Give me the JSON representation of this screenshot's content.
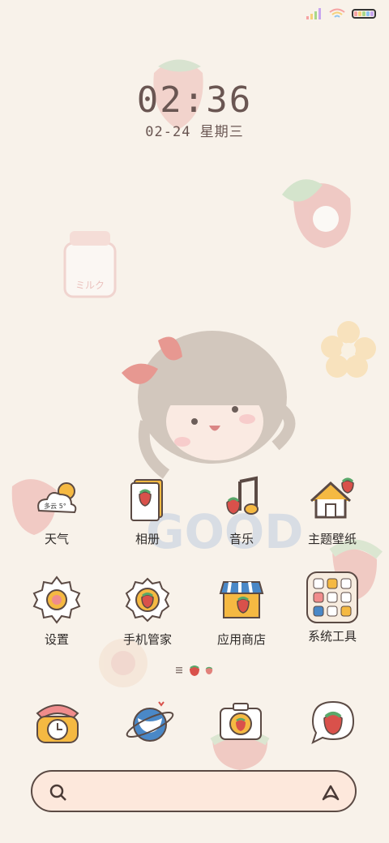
{
  "status_bar": {
    "signal_icon": "signal-icon",
    "wifi_icon": "wifi-icon",
    "battery_icon": "battery-icon",
    "battery_colors": [
      "#f6a3a3",
      "#f6d17a",
      "#a9d88a",
      "#8ec5f0",
      "#c7a6ef"
    ]
  },
  "lock": {
    "time": "02:36",
    "date": "02-24  星期三"
  },
  "wallpaper": {
    "good_text": "GOOD",
    "milk_text": "ミルク"
  },
  "apps": [
    {
      "label": "天气",
      "icon": "weather-icon",
      "weather_text": "多云 5°"
    },
    {
      "label": "相册",
      "icon": "photo-album-icon"
    },
    {
      "label": "音乐",
      "icon": "music-note-icon"
    },
    {
      "label": "主题壁纸",
      "icon": "theme-house-icon"
    },
    {
      "label": "设置",
      "icon": "settings-gear-icon"
    },
    {
      "label": "手机管家",
      "icon": "phone-manager-icon"
    },
    {
      "label": "应用商店",
      "icon": "app-store-icon"
    },
    {
      "label": "系统工具",
      "icon": "system-tools-folder-icon"
    }
  ],
  "dock": [
    {
      "icon": "phone-icon"
    },
    {
      "icon": "browser-planet-icon"
    },
    {
      "icon": "camera-icon"
    },
    {
      "icon": "messages-icon"
    }
  ],
  "page_indicator": {
    "menu_icon": "menu-lines-icon",
    "page_icons": [
      "strawberry-page-icon",
      "strawberry-small-page-icon"
    ]
  },
  "search_bar": {
    "search_icon": "search-icon",
    "assistant_icon": "assistant-icon"
  },
  "colors": {
    "background": "#f8f2ea",
    "outline": "#5b4a44",
    "strawberry": "#d9514b",
    "leaf": "#5aa86a",
    "search_fill": "#fde8dc"
  }
}
